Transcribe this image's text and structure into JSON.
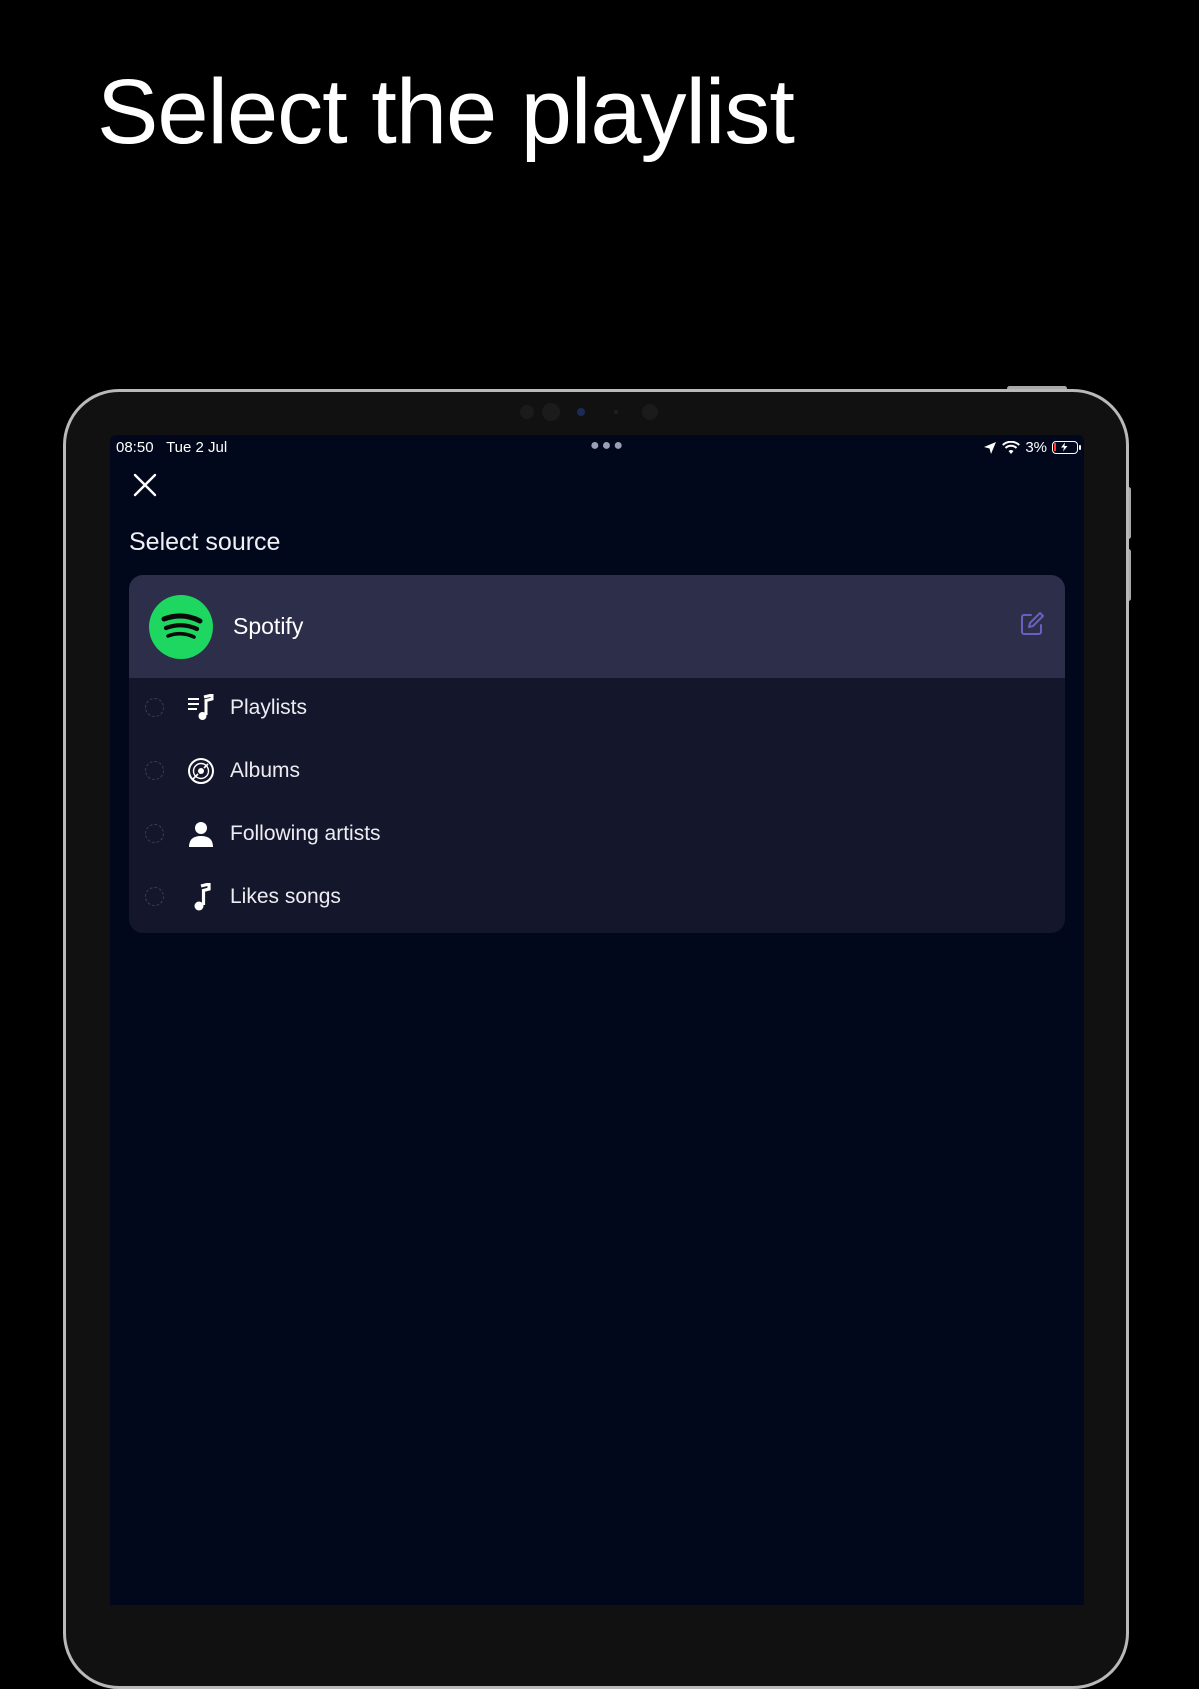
{
  "headline": "Select the playlist",
  "status_bar": {
    "time": "08:50",
    "date": "Tue 2 Jul",
    "battery": "3%"
  },
  "app": {
    "section_title": "Select source",
    "provider": {
      "name": "Spotify",
      "logo_icon": "spotify-logo-icon",
      "brand_color": "#1ed760"
    },
    "options": [
      {
        "label": "Playlists",
        "icon": "playlist-icon",
        "selected": false
      },
      {
        "label": "Albums",
        "icon": "album-disc-icon",
        "selected": false
      },
      {
        "label": "Following artists",
        "icon": "person-icon",
        "selected": false
      },
      {
        "label": "Likes songs",
        "icon": "music-note-icon",
        "selected": false
      }
    ]
  },
  "colors": {
    "page_background": "#000000",
    "screen_background": "#02081c",
    "card_background": "#14172b",
    "card_header_background": "#2d2e4a",
    "edit_icon_color": "#6a5fc1"
  }
}
